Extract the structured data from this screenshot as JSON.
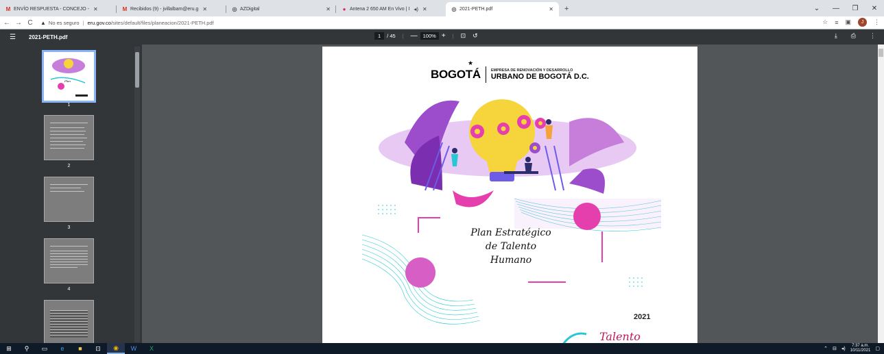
{
  "browser": {
    "tabs": [
      {
        "label": "ENVÍO RESPUESTA - CONCEJO -",
        "icon": "gmail-icon"
      },
      {
        "label": "Recibidos (9) - jvillalbam@eru.g",
        "icon": "gmail-icon"
      },
      {
        "label": "AZDigital",
        "icon": "globe-icon"
      },
      {
        "label": "Antena 2 650 AM En Vivo | I",
        "icon": "radio-icon"
      },
      {
        "label": "2021-PETH.pdf",
        "icon": "globe-icon"
      }
    ],
    "url": {
      "security": "No es seguro",
      "domain": "eru.gov.co",
      "path": "/sites/default/files/planeacion/2021-PETH.pdf"
    },
    "avatar_initial": "J"
  },
  "pdf": {
    "filename": "2021-PETH.pdf",
    "current_page": "1",
    "total_pages": "/ 45",
    "zoom": "100%",
    "thumbnails": [
      "1",
      "2",
      "3",
      "4"
    ]
  },
  "document": {
    "logo_city": "BOGOTÁ",
    "org_line1": "EMPRESA DE RENOVACIÓN Y DESARROLLO",
    "org_line2": "URBANO DE BOGOTÁ D.C.",
    "title_line1": "Plan Estratégico",
    "title_line2": "de Talento",
    "title_line3": "Humano",
    "year": "2021",
    "footer_word": "Talento"
  },
  "taskbar": {
    "time": "7:37 a.m.",
    "date": "10/11/2021"
  },
  "colors": {
    "accent_magenta": "#e53fae",
    "accent_purple": "#9c4dcc",
    "accent_cyan": "#28c7d6",
    "bulb_yellow": "#f6d43b",
    "toolbar": "#323639",
    "viewer_bg": "#525659"
  }
}
